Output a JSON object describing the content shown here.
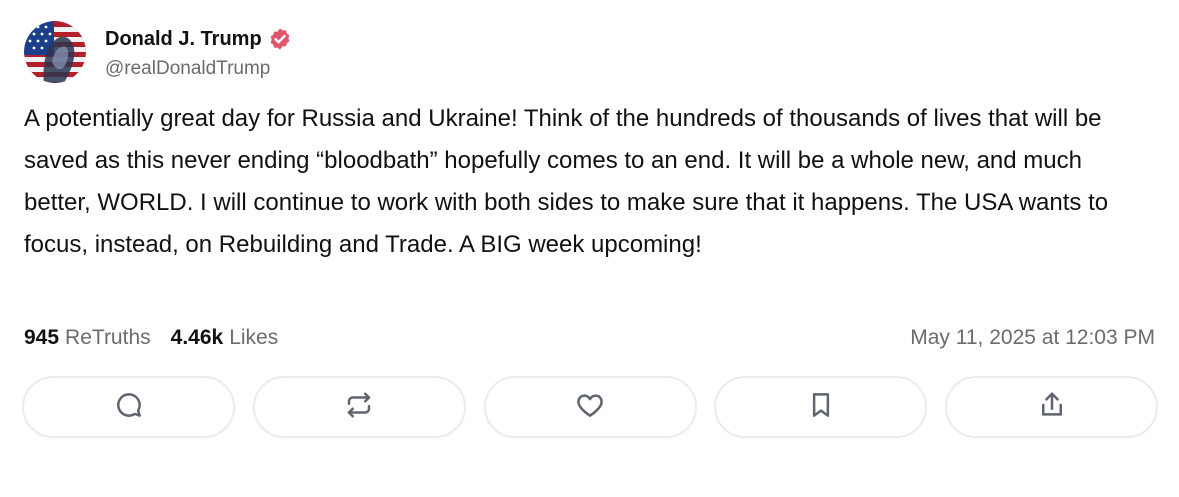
{
  "author": {
    "display_name": "Donald J. Trump",
    "handle": "@realDonaldTrump",
    "verified_icon": "verified-badge-icon",
    "verified_color": "#e0566b"
  },
  "post": {
    "text": "A potentially great day for Russia and Ukraine! Think of the hundreds of thousands of lives that will be saved as this never ending “bloodbath” hopefully comes to an end. It will be a whole new, and much better, WORLD. I will continue to work with both sides to make sure that it happens. The USA wants to focus, instead, on Rebuilding and Trade. A BIG week upcoming!"
  },
  "stats": {
    "retruths_count": "945",
    "retruths_label": "ReTruths",
    "likes_count": "4.46k",
    "likes_label": "Likes",
    "timestamp": "May 11, 2025 at 12:03 PM"
  },
  "actions": [
    {
      "name": "reply",
      "icon": "comment-icon"
    },
    {
      "name": "retruth",
      "icon": "repost-icon"
    },
    {
      "name": "like",
      "icon": "heart-icon"
    },
    {
      "name": "bookmark",
      "icon": "bookmark-icon"
    },
    {
      "name": "share",
      "icon": "share-icon"
    }
  ],
  "colors": {
    "text": "#111111",
    "muted": "#6b6b6b",
    "border": "#ececec",
    "icon": "#5f6470"
  }
}
